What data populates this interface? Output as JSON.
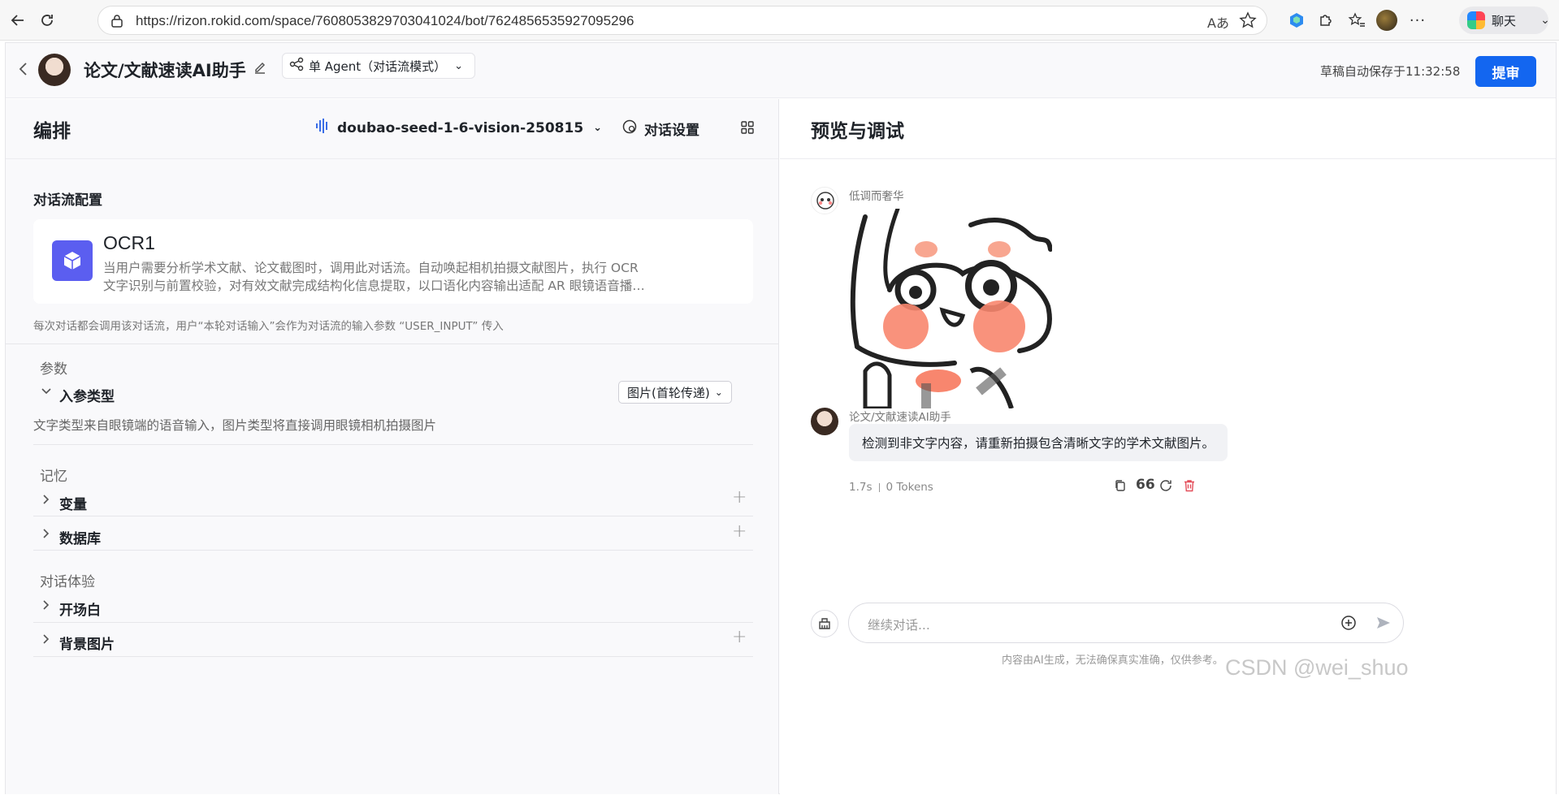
{
  "browser": {
    "url": "https://rizon.rokid.com/space/7608053829703041024/bot/7624856535927095296",
    "chat_label": "聊天"
  },
  "header": {
    "bot_name": "论文/文献速读AI助手",
    "mode_label": "单 Agent（对话流模式）",
    "autosave": "草稿自动保存于11:32:58",
    "submit_label": "提审"
  },
  "left": {
    "title": "编排",
    "model": "doubao-seed-1-6-vision-250815",
    "settings_label": "对话设置",
    "flow_section": "对话流配置",
    "flow_card": {
      "name": "OCR1",
      "desc_line1": "当用户需要分析学术文献、论文截图时，调用此对话流。自动唤起相机拍摄文献图片，执行 OCR",
      "desc_line2": "文字识别与前置校验，对有效文献完成结构化信息提取，以口语化内容输出适配 AR 眼镜语音播…"
    },
    "flow_note": "每次对话都会调用该对话流，用户“本轮对话输入”会作为对话流的输入参数 “USER_INPUT” 传入",
    "params_title": "参数",
    "input_type_label": "入参类型",
    "input_type_value": "图片(首轮传递)",
    "input_type_note": "文字类型来自眼镜端的语音输入，图片类型将直接调用眼镜相机拍摄图片",
    "memory_title": "记忆",
    "memory_items": [
      "变量",
      "数据库"
    ],
    "experience_title": "对话体验",
    "experience_items": [
      "开场白",
      "背景图片"
    ]
  },
  "right": {
    "title": "预览与调试",
    "user_name": "低调而奢华",
    "bot_name": "论文/文献速读AI助手",
    "bot_reply": "检测到非文字内容，请重新拍摄包含清晰文字的学术文献图片。",
    "latency": "1.7s",
    "tokens": "0 Tokens",
    "input_placeholder": "继续对话...",
    "disclaimer": "内容由AI生成，无法确保真实准确，仅供参考。"
  },
  "watermark": "CSDN @wei_shuo",
  "colors": {
    "primary": "#1366f0",
    "accent_purple": "#5b5ef0",
    "delete_red": "#e34d59"
  }
}
